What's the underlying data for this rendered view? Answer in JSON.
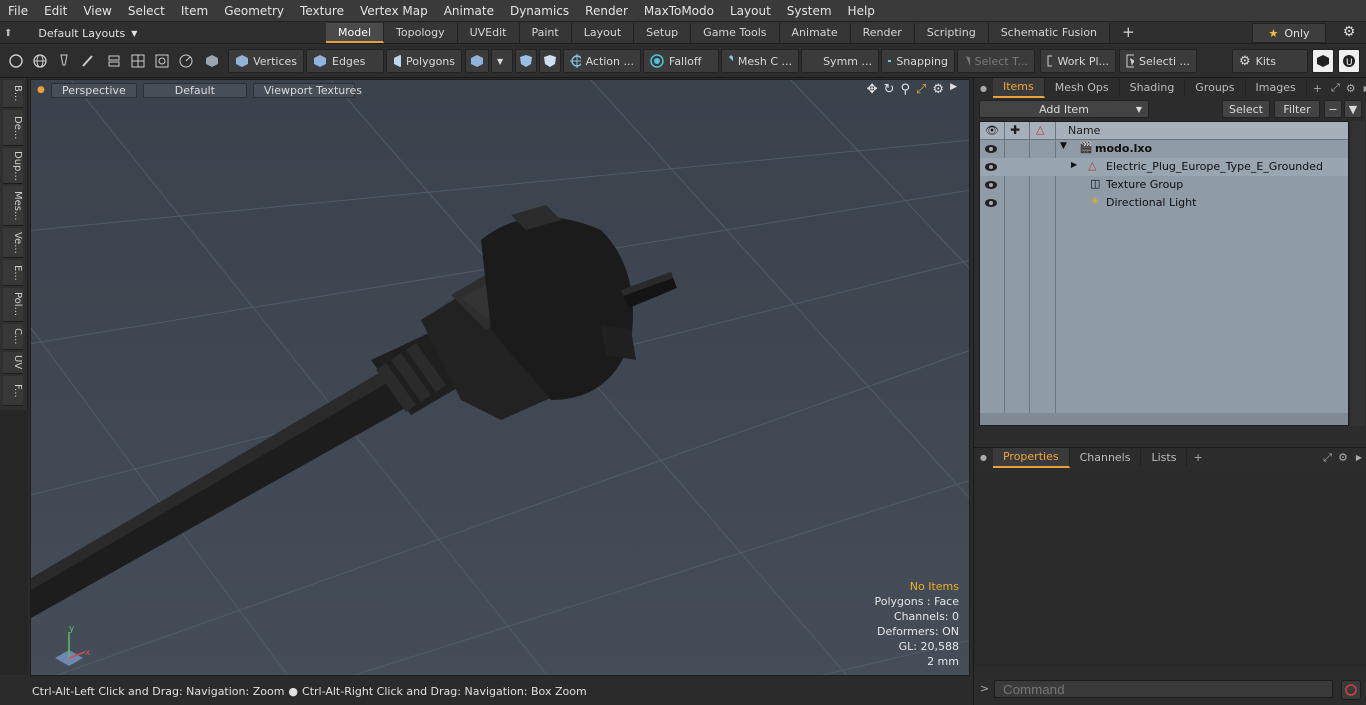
{
  "menu": [
    "File",
    "Edit",
    "View",
    "Select",
    "Item",
    "Geometry",
    "Texture",
    "Vertex Map",
    "Animate",
    "Dynamics",
    "Render",
    "MaxToModo",
    "Layout",
    "System",
    "Help"
  ],
  "layout": {
    "selector_label": "Default Layouts",
    "tabs": [
      "Model",
      "Topology",
      "UVEdit",
      "Paint",
      "Layout",
      "Setup",
      "Game Tools",
      "Animate",
      "Render",
      "Scripting",
      "Schematic Fusion"
    ],
    "active_tab": "Model",
    "only_label": "Only"
  },
  "toolbar": {
    "vertices": "Vertices",
    "edges": "Edges",
    "polygons": "Polygons",
    "action": "Action ...",
    "falloff": "Falloff",
    "mesh": "Mesh C ...",
    "symmetry": "Symm ...",
    "snapping": "Snapping",
    "select_t": "Select T...",
    "work_plane": "Work Pl...",
    "selection": "Selecti ...",
    "kits": "Kits"
  },
  "left_tabs": [
    "B...",
    "De...",
    "Dup...",
    "Mes...",
    "Ve...",
    "E...",
    "Pol...",
    "C...",
    "UV",
    "F..."
  ],
  "viewport": {
    "view_mode": "Perspective",
    "shading": "Default",
    "textures": "Viewport Textures",
    "info": {
      "status": "No Items",
      "polygons": "Polygons : Face",
      "channels": "Channels: 0",
      "deformers": "Deformers: ON",
      "gl": "GL: 20,588",
      "scale": "2 mm"
    },
    "axes": {
      "x": "x",
      "y": "y"
    }
  },
  "status_bar": {
    "hint1": "Ctrl-Alt-Left Click and Drag: Navigation: Zoom",
    "hint2": "Ctrl-Alt-Right Click and Drag: Navigation: Box Zoom"
  },
  "items_panel": {
    "tabs": [
      "Items",
      "Mesh Ops",
      "Shading",
      "Groups",
      "Images"
    ],
    "active_tab": "Items",
    "add_item": "Add Item",
    "select": "Select",
    "filter": "Filter",
    "column_name": "Name",
    "rows": [
      {
        "label": "modo.lxo"
      },
      {
        "label": "Electric_Plug_Europe_Type_E_Grounded"
      },
      {
        "label": "Texture Group"
      },
      {
        "label": "Directional Light"
      }
    ]
  },
  "properties_panel": {
    "tabs": [
      "Properties",
      "Channels",
      "Lists"
    ],
    "active_tab": "Properties"
  },
  "command": {
    "placeholder": "Command"
  },
  "colors": {
    "accent": "#e9a23b",
    "viewport_bg": "#3e4650",
    "list_bg": "#8f9ba7",
    "warning": "#f0b020"
  }
}
